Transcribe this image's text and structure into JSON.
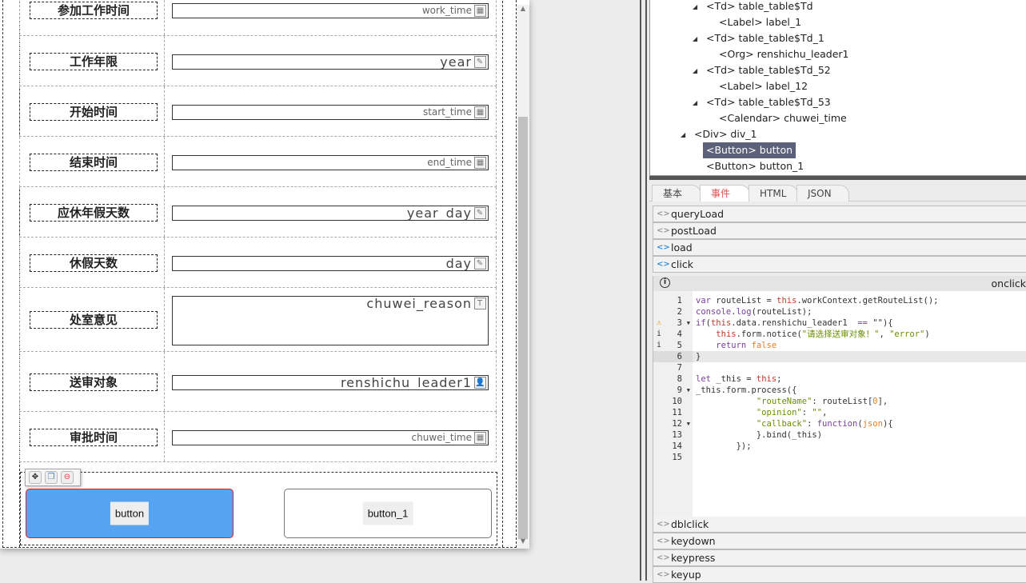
{
  "form": {
    "rows": [
      {
        "label": "参加工作时间",
        "value": "work_time",
        "icon": "calendar-icon",
        "big": false
      },
      {
        "label": "工作年限",
        "value": "year",
        "icon": "edit-icon",
        "big": true
      },
      {
        "label": "开始时间",
        "value": "start_time",
        "icon": "calendar-icon",
        "big": false
      },
      {
        "label": "结束时间",
        "value": "end_time",
        "icon": "calendar-icon",
        "big": false
      },
      {
        "label": "应休年假天数",
        "value": "year_day",
        "icon": "edit-icon",
        "big": true
      },
      {
        "label": "休假天数",
        "value": "day",
        "icon": "edit-icon",
        "big": true
      },
      {
        "label": "处室意见",
        "value": "chuwei_reason",
        "icon": "textarea-icon",
        "big": true
      },
      {
        "label": "送审对象",
        "value": "renshichu_leader1",
        "icon": "person-icon",
        "big": true
      },
      {
        "label": "审批时间",
        "value": "chuwei_time",
        "icon": "calendar-icon",
        "big": false
      }
    ],
    "buttons": {
      "button": "button",
      "button_1": "button_1"
    }
  },
  "tree": {
    "nodes": [
      {
        "text": "<Td> table_table$Td",
        "level": 2,
        "expand": true
      },
      {
        "text": "<Label> label_1",
        "level": 3
      },
      {
        "text": "<Td> table_table$Td_1",
        "level": 2,
        "expand": true
      },
      {
        "text": "<Org> renshichu_leader1",
        "level": 3
      },
      {
        "text": "<Td> table_table$Td_52",
        "level": 2,
        "expand": true
      },
      {
        "text": "<Label> label_12",
        "level": 3
      },
      {
        "text": "<Td> table_table$Td_53",
        "level": 2,
        "expand": true
      },
      {
        "text": "<Calendar> chuwei_time",
        "level": 3
      },
      {
        "text": "<Div> div_1",
        "level": 1,
        "expand": true
      },
      {
        "text": "<Button> button",
        "level": 2,
        "selected": true
      },
      {
        "text": "<Button> button_1",
        "level": 2
      }
    ]
  },
  "tabs": [
    "基本",
    "事件",
    "HTML",
    "JSON"
  ],
  "active_tab": 1,
  "events_top": [
    {
      "name": "queryLoad",
      "set": false
    },
    {
      "name": "postLoad",
      "set": false
    },
    {
      "name": "load",
      "set": true
    },
    {
      "name": "click",
      "set": true
    }
  ],
  "events_bottom": [
    {
      "name": "dblclick",
      "set": false
    },
    {
      "name": "keydown",
      "set": false
    },
    {
      "name": "keypress",
      "set": false
    },
    {
      "name": "keyup",
      "set": false
    }
  ],
  "editor": {
    "title": "onclick",
    "current_line": 6,
    "lines": [
      {
        "n": "1",
        "tok": [
          [
            "var ",
            "k"
          ],
          [
            "routeList = ",
            "p"
          ],
          [
            "this",
            "t"
          ],
          [
            ".workContext.getRouteList();",
            "p"
          ]
        ]
      },
      {
        "n": "2",
        "tok": [
          [
            "console",
            "k"
          ],
          [
            ".",
            "p"
          ],
          [
            "log",
            "k"
          ],
          [
            "(routeList);",
            "p"
          ]
        ]
      },
      {
        "n": "3",
        "mark": "⚠",
        "fold": true,
        "tok": [
          [
            "if",
            "k"
          ],
          [
            "(",
            "p"
          ],
          [
            "this",
            "t"
          ],
          [
            ".data.renshichu_leader1  ",
            "p"
          ],
          [
            "==",
            "k"
          ],
          [
            " \"\"){",
            "p"
          ]
        ]
      },
      {
        "n": "4",
        "mark": "i",
        "tok": [
          [
            "    ",
            "p"
          ],
          [
            "this",
            "t"
          ],
          [
            ".form.notice(",
            "p"
          ],
          [
            "\"请选择送审对象！\"",
            "s"
          ],
          [
            ", ",
            "p"
          ],
          [
            "\"error\"",
            "s"
          ],
          [
            ")",
            "p"
          ]
        ]
      },
      {
        "n": "5",
        "mark": "i",
        "tok": [
          [
            "    ",
            "p"
          ],
          [
            "return ",
            "k"
          ],
          [
            "false",
            "n"
          ]
        ]
      },
      {
        "n": "6",
        "tok": [
          [
            "}",
            "p"
          ]
        ]
      },
      {
        "n": "7",
        "tok": []
      },
      {
        "n": "8",
        "tok": [
          [
            "let ",
            "k"
          ],
          [
            "_this = ",
            "p"
          ],
          [
            "this",
            "t"
          ],
          [
            ";",
            "p"
          ]
        ]
      },
      {
        "n": "9",
        "fold": true,
        "tok": [
          [
            "_this.form.process({",
            "p"
          ]
        ]
      },
      {
        "n": "10",
        "tok": [
          [
            "            ",
            "p"
          ],
          [
            "\"routeName\"",
            "s"
          ],
          [
            ": routeList[",
            "p"
          ],
          [
            "0",
            "n"
          ],
          [
            "],",
            "p"
          ]
        ]
      },
      {
        "n": "11",
        "tok": [
          [
            "            ",
            "p"
          ],
          [
            "\"opinion\"",
            "s"
          ],
          [
            ": ",
            "p"
          ],
          [
            "\"\"",
            "s"
          ],
          [
            ",",
            "p"
          ]
        ]
      },
      {
        "n": "12",
        "fold": true,
        "tok": [
          [
            "            ",
            "p"
          ],
          [
            "\"callback\"",
            "s"
          ],
          [
            ": ",
            "p"
          ],
          [
            "function",
            "k"
          ],
          [
            "(",
            "p"
          ],
          [
            "json",
            "n"
          ],
          [
            "){",
            "p"
          ]
        ]
      },
      {
        "n": "13",
        "tok": [
          [
            "            }.bind(_this)",
            "p"
          ]
        ]
      },
      {
        "n": "14",
        "tok": [
          [
            "        });",
            "p"
          ]
        ]
      },
      {
        "n": "15",
        "tok": []
      }
    ]
  }
}
